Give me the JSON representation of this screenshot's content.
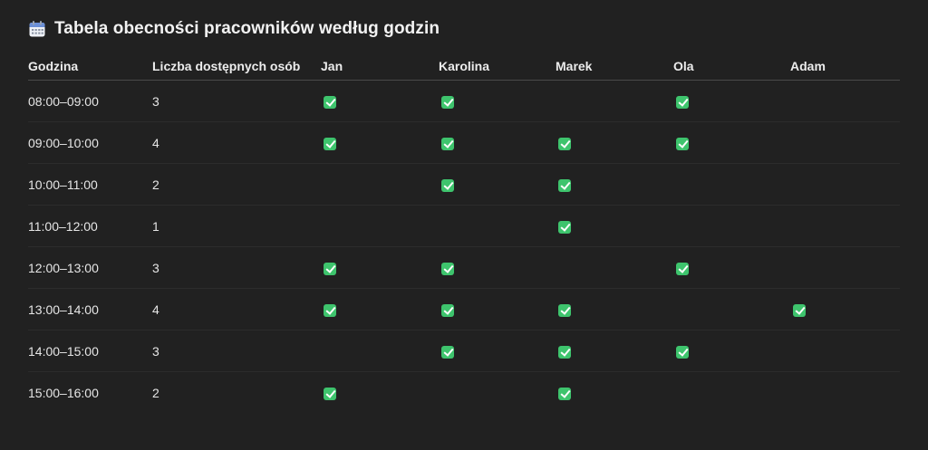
{
  "heading": {
    "icon": "calendar-icon",
    "title": "Tabela obecności pracowników według godzin"
  },
  "table": {
    "columns": [
      "Godzina",
      "Liczba dostępnych osób",
      "Jan",
      "Karolina",
      "Marek",
      "Ola",
      "Adam"
    ],
    "rows": [
      {
        "hour": "08:00–09:00",
        "count": "3",
        "presence": [
          true,
          true,
          false,
          true,
          false
        ]
      },
      {
        "hour": "09:00–10:00",
        "count": "4",
        "presence": [
          true,
          true,
          true,
          true,
          false
        ]
      },
      {
        "hour": "10:00–11:00",
        "count": "2",
        "presence": [
          false,
          true,
          true,
          false,
          false
        ]
      },
      {
        "hour": "11:00–12:00",
        "count": "1",
        "presence": [
          false,
          false,
          true,
          false,
          false
        ]
      },
      {
        "hour": "12:00–13:00",
        "count": "3",
        "presence": [
          true,
          true,
          false,
          true,
          false
        ]
      },
      {
        "hour": "13:00–14:00",
        "count": "4",
        "presence": [
          true,
          true,
          true,
          false,
          true
        ]
      },
      {
        "hour": "14:00–15:00",
        "count": "3",
        "presence": [
          false,
          true,
          true,
          true,
          false
        ]
      },
      {
        "hour": "15:00–16:00",
        "count": "2",
        "presence": [
          true,
          false,
          true,
          false,
          false
        ]
      }
    ],
    "check_icon": "check-mark-icon",
    "check_color": "#3ec46d"
  },
  "colors": {
    "background": "#212121",
    "text": "#ececec"
  }
}
